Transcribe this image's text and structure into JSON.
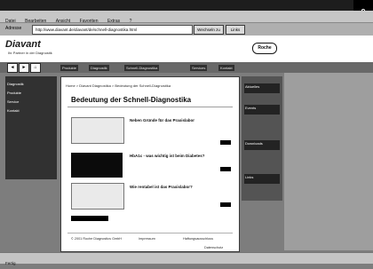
{
  "browser": {
    "menu": [
      "Datei",
      "Bearbeiten",
      "Ansicht",
      "Favoriten",
      "Extras",
      "?"
    ],
    "address_label": "Adresse",
    "address": "http://www.diavant.de/diavant/de/schnell-diagnostika.html",
    "go": "Wechseln zu",
    "links": "Links",
    "status": "Fertig"
  },
  "site": {
    "brand": "Diavant",
    "tagline": "Ihr Partner in der Diagnostik",
    "partner_logo": "Roche",
    "nav_buttons": [
      "◄",
      "►",
      "⌂"
    ],
    "nav_items": [
      "Produkte",
      "Diagnostik",
      "Schnell-Diagnostika",
      "Services",
      "Kontakt"
    ]
  },
  "left": {
    "items": [
      "Diagnostik",
      "Produkte",
      "Service",
      "Kontakt"
    ]
  },
  "main": {
    "breadcrumb": "Home > Diavant Diagnostika > Bedeutung der Schnell-Diagnostika",
    "title": "Bedeutung der Schnell-Diagnostika",
    "articles": [
      {
        "title": "Neben Gründe für das Praxislabor"
      },
      {
        "title": "HbA1c - was wichtig ist beim Diabetes?"
      },
      {
        "title": "Wie rentabel ist das Praxislabor?"
      }
    ],
    "footer": [
      "© 2001 Roche Diagnostics GmbH",
      "Impressum",
      "Haftungsausschluss",
      "Datenschutz"
    ]
  },
  "right": {
    "items": [
      "Aktuelles",
      "Events",
      "Downloads",
      "Links"
    ]
  }
}
